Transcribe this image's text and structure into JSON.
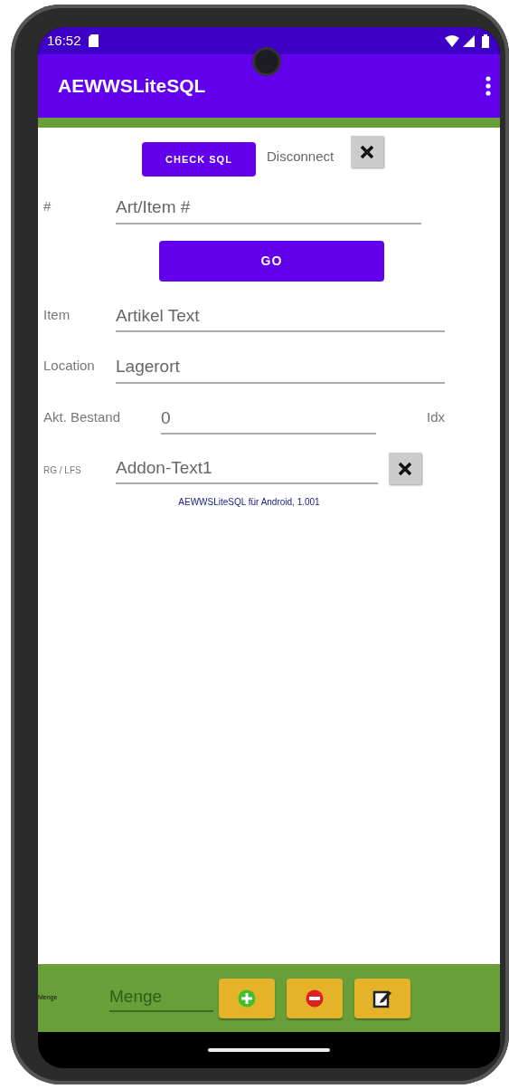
{
  "status_bar": {
    "time": "16:52"
  },
  "app_bar": {
    "title": "AEWWSLiteSQL"
  },
  "toolbar": {
    "check_button": "CHECK SQL",
    "status_label": "Disconnect"
  },
  "rows": [
    {
      "kind": "field",
      "label": "#",
      "placeholder": "Art/Item #"
    },
    {
      "kind": "button",
      "label": "GO"
    },
    {
      "kind": "field",
      "label": "Item",
      "placeholder": "Artikel Text"
    },
    {
      "kind": "field",
      "label": "Location",
      "placeholder": "Lagerort"
    },
    {
      "kind": "field",
      "label": "Akt. Bestand",
      "placeholder": "0",
      "suffix": "Idx"
    },
    {
      "kind": "field",
      "label": "RG / LFS",
      "placeholder": "Addon-Text1",
      "clear_button": true
    }
  ],
  "footer_note": "AEWWSLiteSQL für Android, 1.001",
  "bottom_bar": {
    "label": "Menge",
    "placeholder": "Menge",
    "buttons": [
      {
        "kind": "add"
      },
      {
        "kind": "remove"
      },
      {
        "kind": "edit"
      }
    ]
  }
}
